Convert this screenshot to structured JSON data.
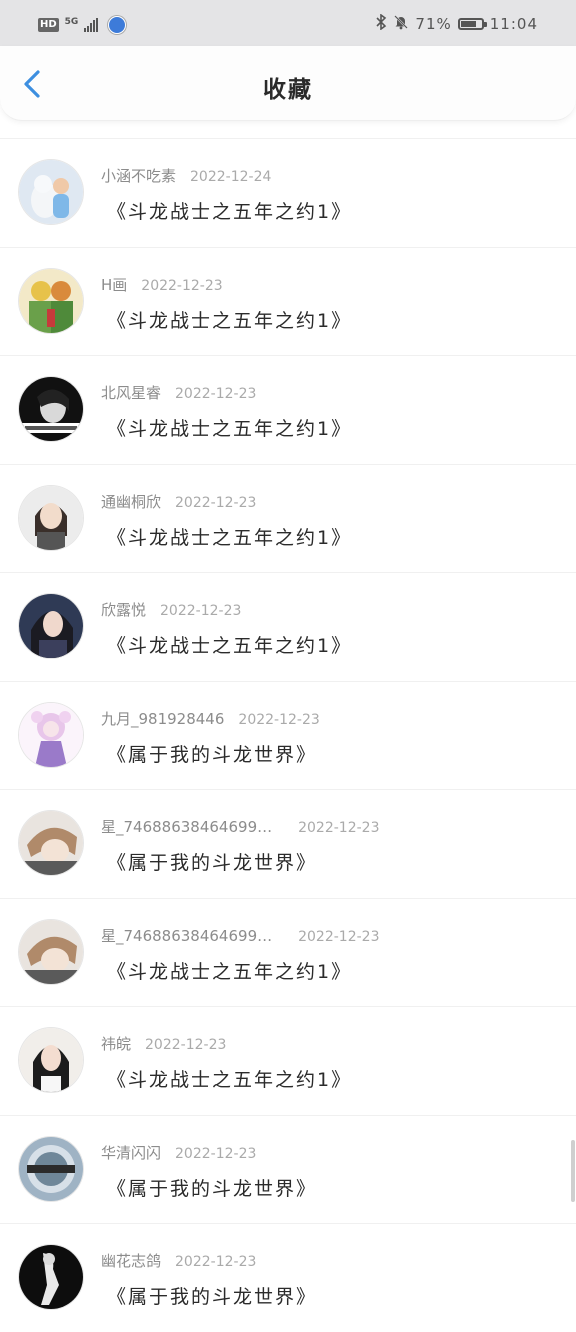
{
  "status_bar": {
    "hd": "HD",
    "network": "5G",
    "battery_text": "71%",
    "time": "11:04"
  },
  "header": {
    "title": "收藏"
  },
  "favorites": [
    {
      "user": "小涵不吃素",
      "date": "2022-12-24",
      "book": "《斗龙战士之五年之约1》"
    },
    {
      "user": "H画",
      "date": "2022-12-23",
      "book": "《斗龙战士之五年之约1》"
    },
    {
      "user": "北风星睿",
      "date": "2022-12-23",
      "book": "《斗龙战士之五年之约1》"
    },
    {
      "user": "通幽桐欣",
      "date": "2022-12-23",
      "book": "《斗龙战士之五年之约1》"
    },
    {
      "user": "欣露悦",
      "date": "2022-12-23",
      "book": "《斗龙战士之五年之约1》"
    },
    {
      "user": "九月_981928446",
      "date": "2022-12-23",
      "book": "《属于我的斗龙世界》"
    },
    {
      "user": "星_74688638464699…",
      "date": "2022-12-23",
      "book": "《属于我的斗龙世界》"
    },
    {
      "user": "星_74688638464699…",
      "date": "2022-12-23",
      "book": "《斗龙战士之五年之约1》"
    },
    {
      "user": "祎皖",
      "date": "2022-12-23",
      "book": "《斗龙战士之五年之约1》"
    },
    {
      "user": "华清闪闪",
      "date": "2022-12-23",
      "book": "《属于我的斗龙世界》"
    },
    {
      "user": "幽花志鸽",
      "date": "2022-12-23",
      "book": "《属于我的斗龙世界》"
    }
  ],
  "colors": {
    "status_bar_bg": "#e4e4e6",
    "back_arrow": "#3d8fe0",
    "title_text": "#2a2a2a",
    "meta_text": "#8c8c8c"
  }
}
